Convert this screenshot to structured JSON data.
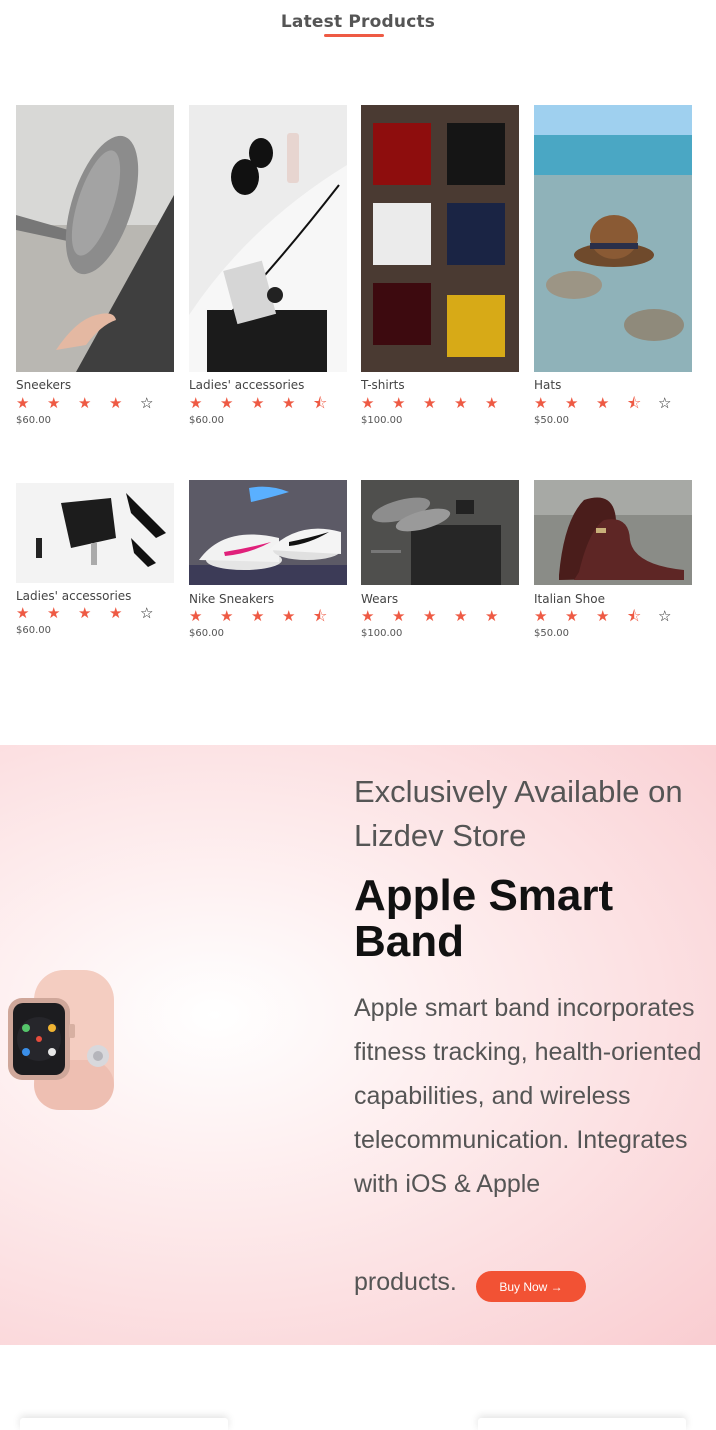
{
  "latest": {
    "title": "Latest Products"
  },
  "products": [
    {
      "name": "Sneekers",
      "price": "$60.00",
      "rating": 4
    },
    {
      "name": "Ladies' accessories",
      "price": "$60.00",
      "rating": 4.5
    },
    {
      "name": "T-shirts",
      "price": "$100.00",
      "rating": 5
    },
    {
      "name": "Hats",
      "price": "$50.00",
      "rating": 3.5
    },
    {
      "name": "Ladies' accessories",
      "price": "$60.00",
      "rating": 4
    },
    {
      "name": "Nike Sneakers",
      "price": "$60.00",
      "rating": 4.5
    },
    {
      "name": "Wears",
      "price": "$100.00",
      "rating": 5
    },
    {
      "name": "Italian Shoe",
      "price": "$50.00",
      "rating": 3.5
    }
  ],
  "promo": {
    "subtitle": "Exclusively Available on Lizdev Store",
    "title": "Apple Smart Band",
    "description": "Apple smart band incorporates fitness tracking, health-oriented capabilities, and wireless telecommunication. Integrates with iOS & Apple",
    "description_end": "products.",
    "button_label": "Buy Now →"
  },
  "colors": {
    "accent": "#ee5a44",
    "button": "#f25234"
  }
}
